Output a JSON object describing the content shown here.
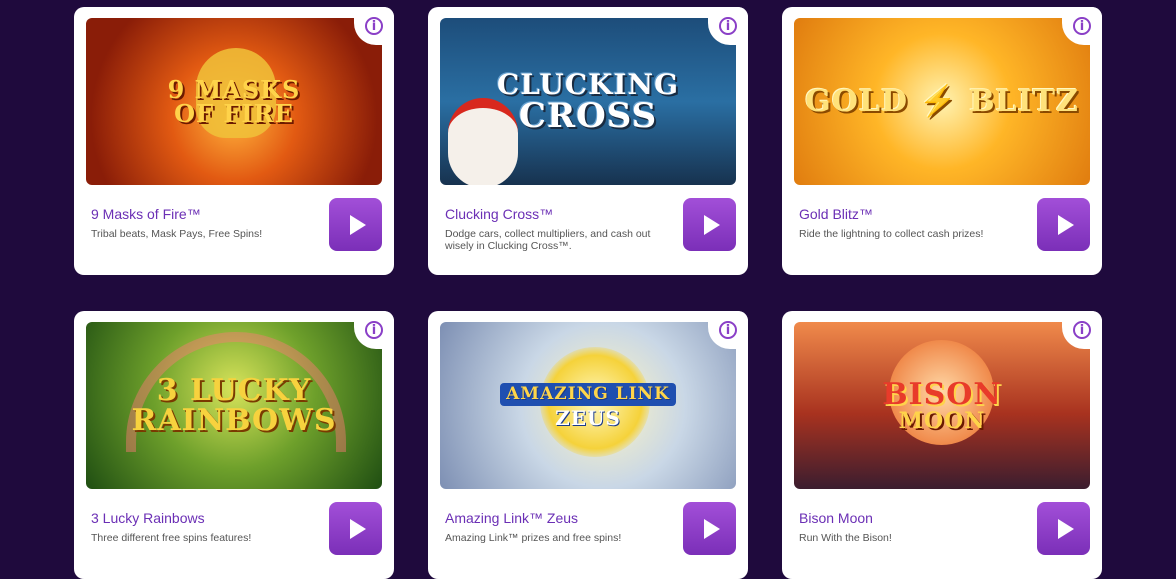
{
  "games": [
    {
      "title": "9 Masks of Fire™",
      "description": "Tribal beats, Mask Pays, Free Spins!",
      "logo_line1": "9 MASKS",
      "logo_line2": "OF FIRE"
    },
    {
      "title": "Clucking Cross™",
      "description": "Dodge cars, collect multipliers, and cash out wisely in Clucking Cross™.",
      "logo_line1": "CLUCKING",
      "logo_line2": "CROSS"
    },
    {
      "title": "Gold Blitz™",
      "description": "Ride the lightning to collect cash prizes!",
      "logo_line1": "GOLD ⚡ BLITZ",
      "logo_line2": ""
    },
    {
      "title": "3 Lucky Rainbows",
      "description": "Three different free spins features!",
      "logo_line1": "3 LUCKY",
      "logo_line2": "RAINBOWS"
    },
    {
      "title": "Amazing Link™ Zeus",
      "description": "Amazing Link™ prizes and free spins!",
      "logo_line1": "AMAZING LINK",
      "logo_line2": "ZEUS"
    },
    {
      "title": "Bison Moon",
      "description": "Run With the Bison!",
      "logo_line1": "BISON",
      "logo_line2": "MOON"
    }
  ],
  "info_glyph": "i",
  "colors": {
    "page_background": "#1f0a3d",
    "accent_purple": "#8a3fc7",
    "title_purple": "#6b2fb5"
  }
}
